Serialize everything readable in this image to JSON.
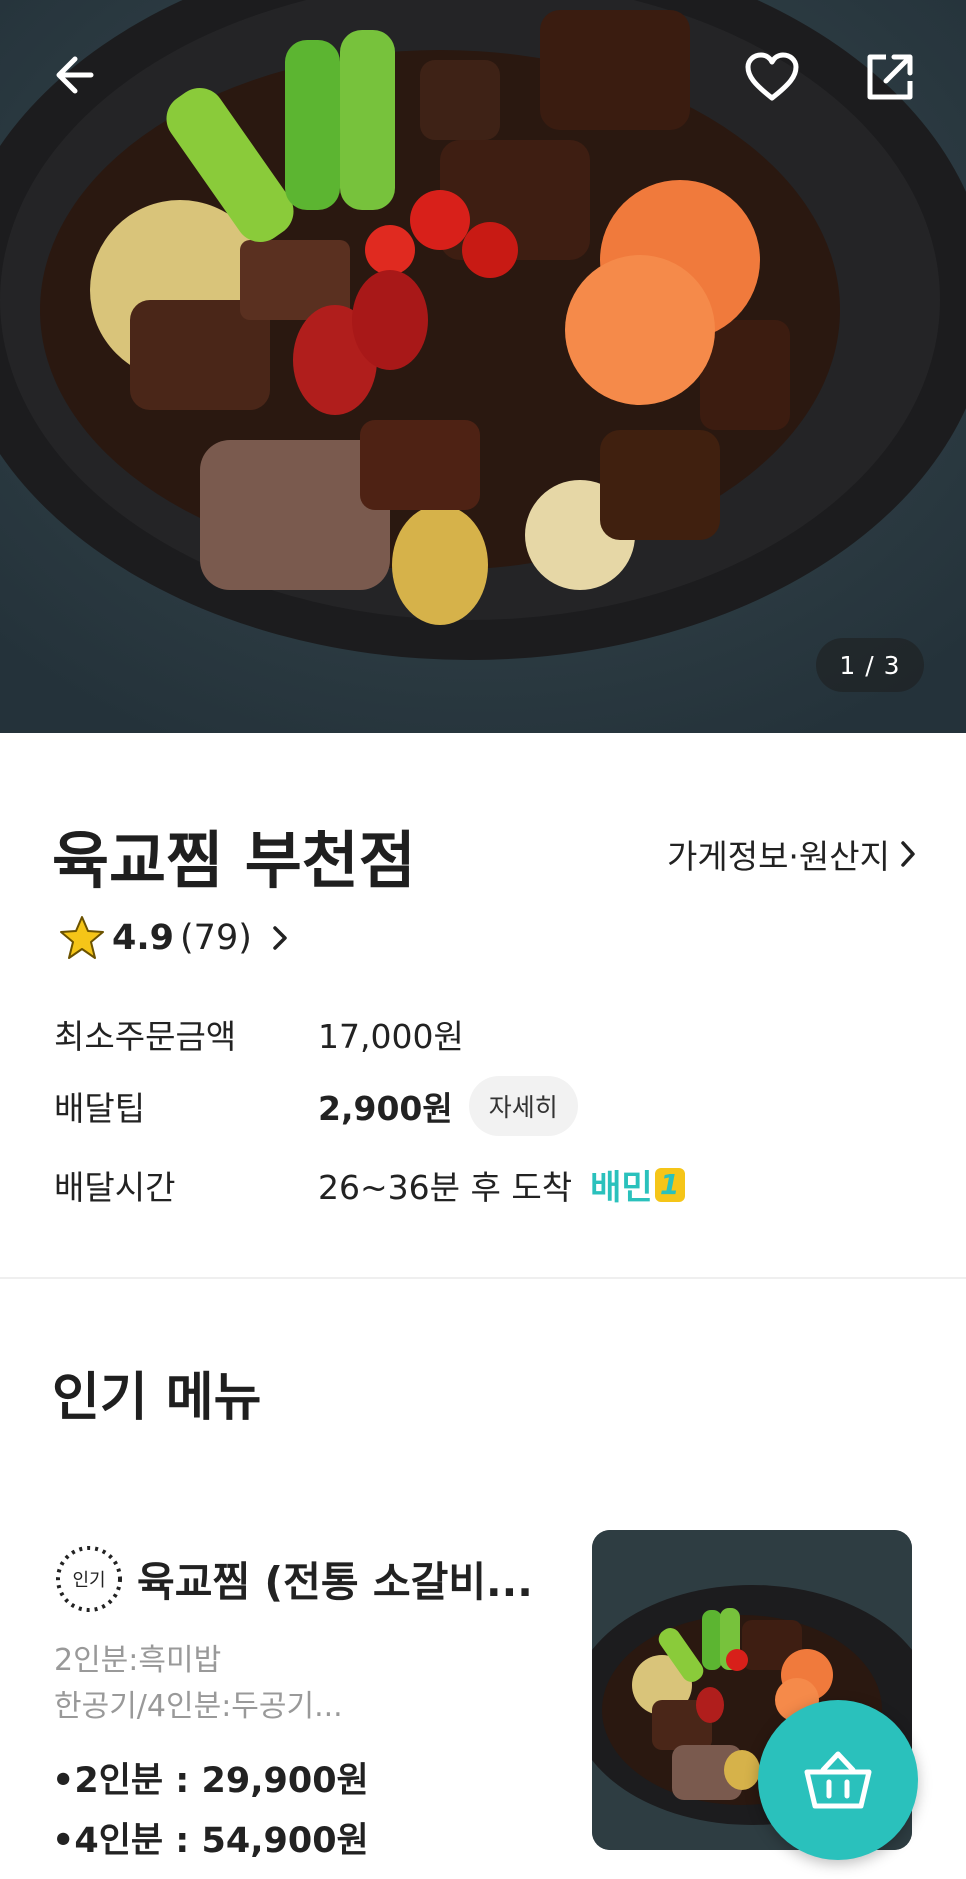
{
  "hero": {
    "image_counter": "1 / 3",
    "icons": {
      "back": "back-arrow-icon",
      "like": "heart-icon",
      "share": "share-icon"
    }
  },
  "store": {
    "name": "육교찜 부천점",
    "info_link": "가게정보·원산지",
    "rating_score": "4.9",
    "review_count": "(79)",
    "min_order_label": "최소주문금액",
    "min_order_value": "17,000원",
    "tip_label": "배달팁",
    "tip_value": "2,900원",
    "tip_detail_button": "자세히",
    "time_label": "배달시간",
    "time_value": "26~36분 후 도착",
    "badge_text": "배민",
    "badge_number": "1"
  },
  "popular": {
    "title": "인기 메뉴",
    "item": {
      "badge": "인기",
      "name": "육교찜 (전통 소갈비...",
      "desc_line1": "2인분:흑미밥",
      "desc_line2": "한공기/4인분:두공기...",
      "price1": "•2인분 : 29,900원",
      "price2": "•4인분 : 54,900원"
    }
  },
  "colors": {
    "accent": "#2ac1bc",
    "star": "#f5c518"
  }
}
